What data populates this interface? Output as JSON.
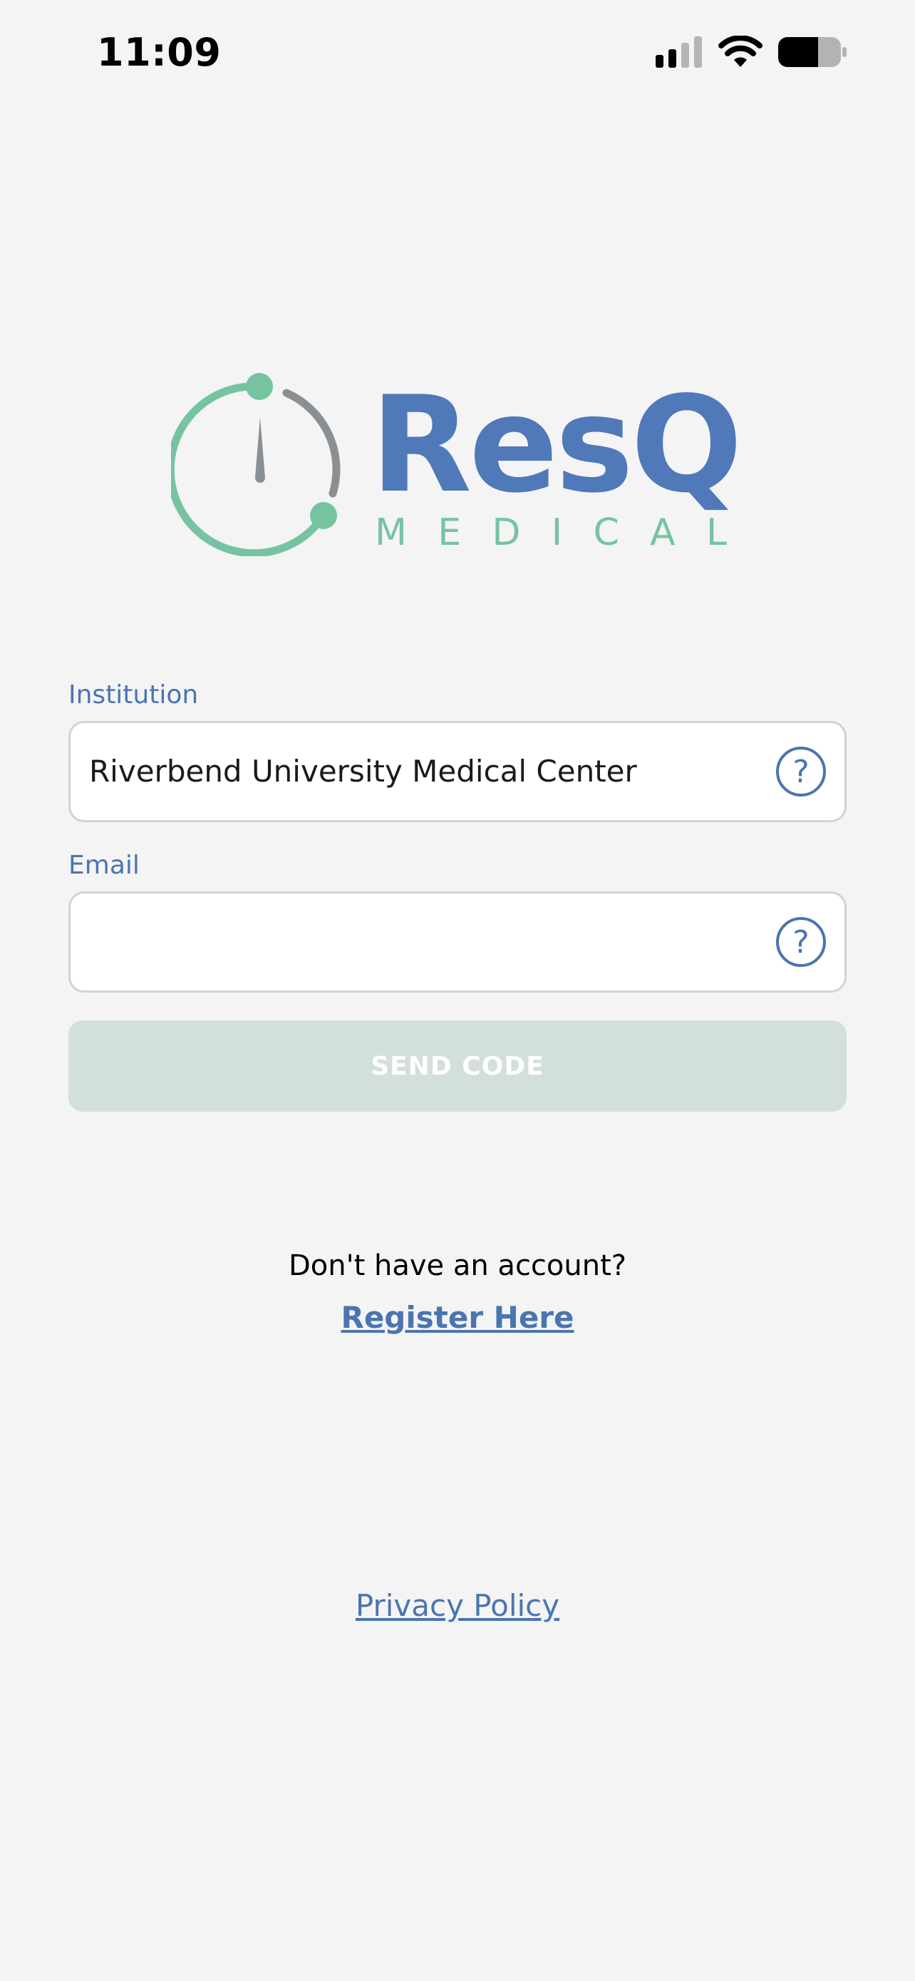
{
  "status_bar": {
    "time": "11:09"
  },
  "icons": {
    "signal": "cellular-signal-icon",
    "wifi": "wifi-icon",
    "battery": "battery-icon",
    "help": "question-circle-icon"
  },
  "logo": {
    "brand": "ResQ",
    "sub": "MEDICAL",
    "colors": {
      "blue": "#4f79b9",
      "green": "#76c3a2",
      "gray": "#8a8f94"
    }
  },
  "form": {
    "institution": {
      "label": "Institution",
      "value": "Riverbend University Medical Center"
    },
    "email": {
      "label": "Email",
      "value": ""
    },
    "send_button": "SEND CODE"
  },
  "account_prompt": "Don't have an account?",
  "register_link": "Register Here",
  "privacy_link": "Privacy Policy",
  "colors": {
    "accent": "#4a75b0",
    "background": "#f4f4f4",
    "button_disabled": "#d2dfdd"
  }
}
